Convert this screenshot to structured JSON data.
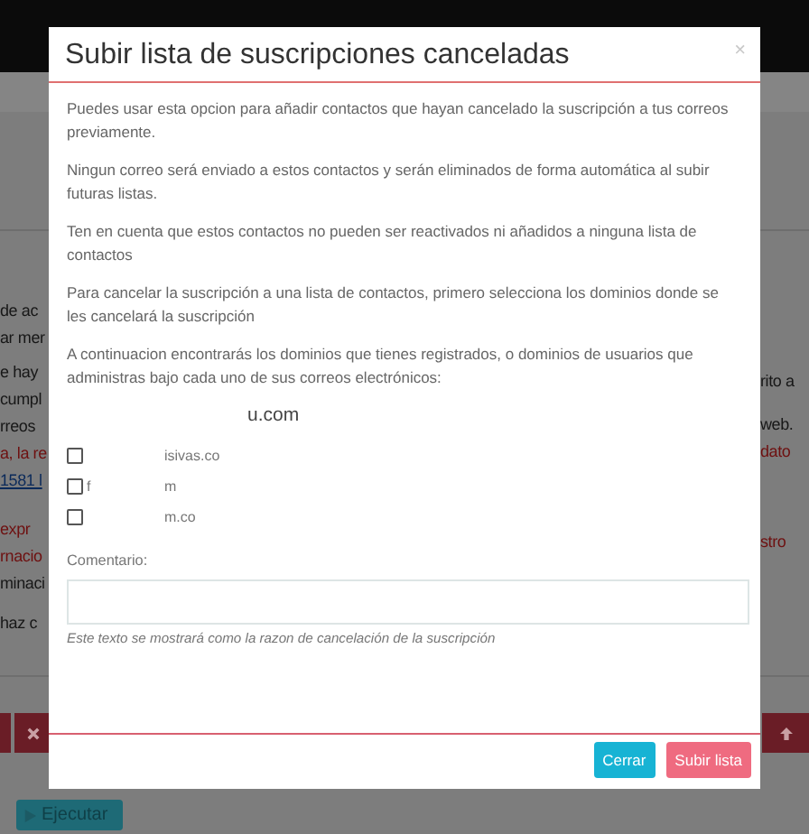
{
  "background": {
    "left_lines": [
      {
        "text": "de ac",
        "kind": "plain"
      },
      {
        "text": "ar mer",
        "kind": "plain"
      },
      {
        "text": "e hay",
        "kind": "plain"
      },
      {
        "text": "cumpl",
        "kind": "plain"
      },
      {
        "text": "rreos",
        "kind": "plain"
      },
      {
        "text": "a, la re",
        "kind": "alert"
      },
      {
        "text": "1581 l",
        "kind": "link"
      },
      {
        "text": "expr",
        "kind": "alert"
      },
      {
        "text": "rnacio",
        "kind": "alert"
      },
      {
        "text": "minaci",
        "kind": "plain"
      },
      {
        "text": "haz c",
        "kind": "plain"
      }
    ],
    "right_lines": [
      {
        "text": "rito a",
        "kind": "plain"
      },
      {
        "text": "web.",
        "kind": "plain"
      },
      {
        "text": "dato",
        "kind": "alert"
      },
      {
        "text": "stro",
        "kind": "alert"
      }
    ],
    "run_button": {
      "label": "Ejecutar"
    }
  },
  "modal": {
    "title": "Subir lista de suscripciones canceladas",
    "close": "×",
    "paragraphs": [
      "Puedes usar esta opcion para añadir contactos que hayan cancelado la suscripción a tus correos previamente.",
      "Ningun correo será enviado a estos contactos y serán eliminados de forma automática al subir futuras listas.",
      "Ten en cuenta que estos contactos no pueden ser reactivados ni añadidos a ninguna lista de contactos",
      "Para cancelar la suscripción a una lista de contactos, primero selecciona los dominios donde se les cancelará la suscripción",
      "A continuacion encontrarás los dominios que tienes registrados, o dominios de usuarios que administras bajo cada uno de sus correos electrónicos:"
    ],
    "group_heading": "u.com",
    "domains": [
      {
        "end": "isivas.co",
        "checked": false
      },
      {
        "start": "f",
        "end": "m",
        "checked": false
      },
      {
        "end": "m.co",
        "checked": false
      }
    ],
    "comment_label": "Comentario:",
    "comment_help": "Este texto se mostrará como la razon de cancelación de la suscripción",
    "buttons": [
      {
        "label": "Cerrar",
        "kind": "secondary"
      },
      {
        "label": "Subir lista",
        "kind": "primary"
      }
    ]
  }
}
